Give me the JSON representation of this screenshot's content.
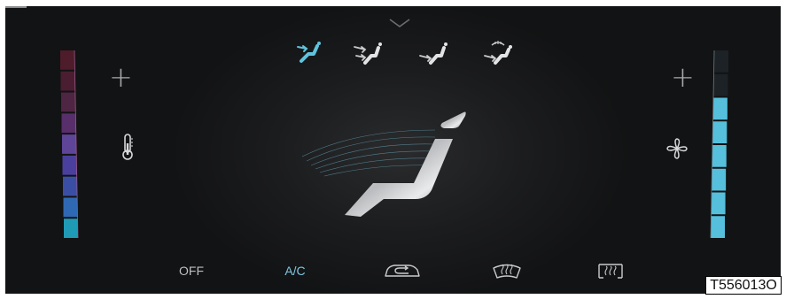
{
  "screen": {
    "background": "#1b1c1e",
    "accent": "#5fc3dd"
  },
  "airflow_modes": [
    {
      "name": "face",
      "icon": "airflow-face-icon",
      "active": true
    },
    {
      "name": "face-and-feet",
      "icon": "airflow-face-feet-icon",
      "active": false
    },
    {
      "name": "feet",
      "icon": "airflow-feet-icon",
      "active": false
    },
    {
      "name": "feet-and-windshield",
      "icon": "airflow-feet-defrost-icon",
      "active": false
    }
  ],
  "temperature": {
    "segments_total": 9,
    "colors": [
      "#1f9bb6",
      "#2f69b4",
      "#3a4fa3",
      "#4b3f9e",
      "#5e4598",
      "#582f6a",
      "#4e2542",
      "#4a1e30",
      "#4e1c2a"
    ],
    "plus_label": "+",
    "icon": "thermometer-icon"
  },
  "fan": {
    "level": 6,
    "segments_total": 8,
    "active_color": "#55bfdc",
    "inactive_color": "#1d2226",
    "plus_label": "+",
    "icon": "fan-icon"
  },
  "bottom_buttons": {
    "off_label": "OFF",
    "ac_label": "A/C",
    "recirc_icon": "recirculation-icon",
    "front_defrost_icon": "front-defrost-icon",
    "rear_defrost_icon": "rear-defrost-icon"
  },
  "figure_code": "T556013O"
}
